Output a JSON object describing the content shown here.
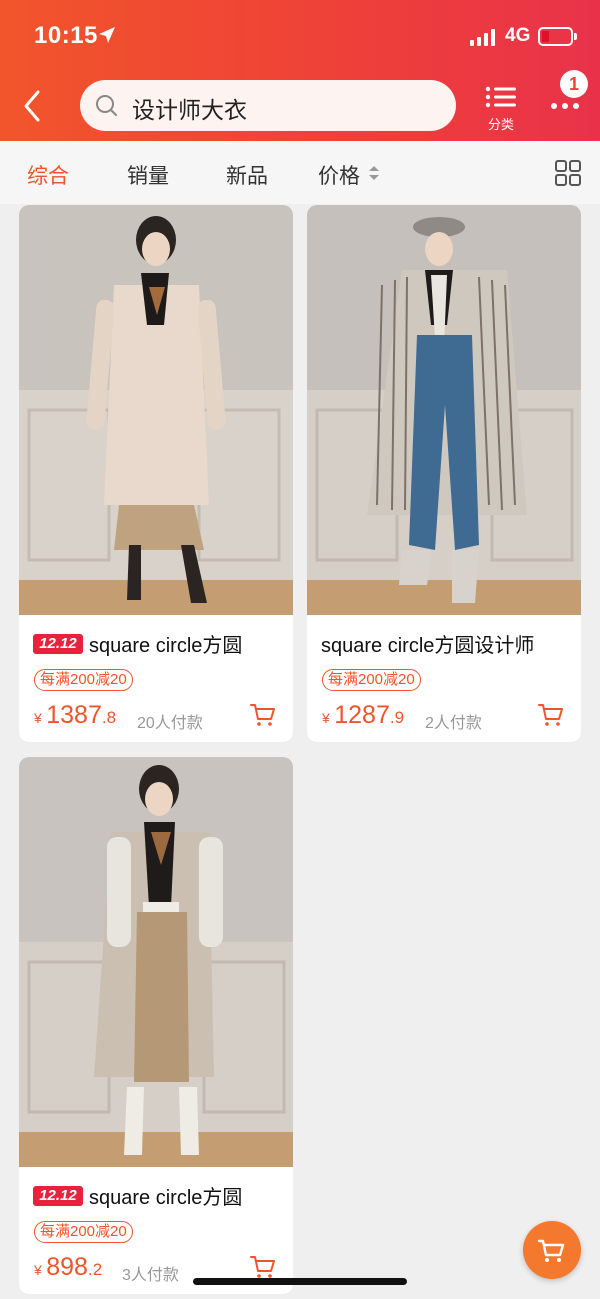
{
  "status": {
    "time": "10:15",
    "network": "4G",
    "battery_level": 0.2
  },
  "header": {
    "search_value": "设计师大衣",
    "category_label": "分类",
    "more_badge": "1"
  },
  "sort": {
    "tabs": [
      {
        "label": "综合",
        "active": true
      },
      {
        "label": "销量",
        "active": false
      },
      {
        "label": "新品",
        "active": false
      },
      {
        "label": "价格",
        "active": false
      }
    ]
  },
  "products": [
    {
      "tag": "12.12",
      "title": "square circle方圆",
      "promo": "每满200减20",
      "currency": "¥",
      "price_int": "1387",
      "price_dec": ".8",
      "paid": "20人付款"
    },
    {
      "tag": "",
      "title": "square circle方圆设计师",
      "promo": "每满200减20",
      "currency": "¥",
      "price_int": "1287",
      "price_dec": ".9",
      "paid": "2人付款"
    },
    {
      "tag": "12.12",
      "title": "square circle方圆",
      "promo": "每满200减20",
      "currency": "¥",
      "price_int": "898",
      "price_dec": ".2",
      "paid": "3人付款"
    }
  ],
  "colors": {
    "accent": "#f0542b",
    "header_start": "#f2552b",
    "header_end": "#e9324a",
    "float_cart": "#f5782f"
  },
  "icons": [
    "location-arrow-icon",
    "back-icon",
    "search-icon",
    "list-icon",
    "more-icon",
    "sort-icon",
    "grid-icon",
    "cart-icon"
  ]
}
